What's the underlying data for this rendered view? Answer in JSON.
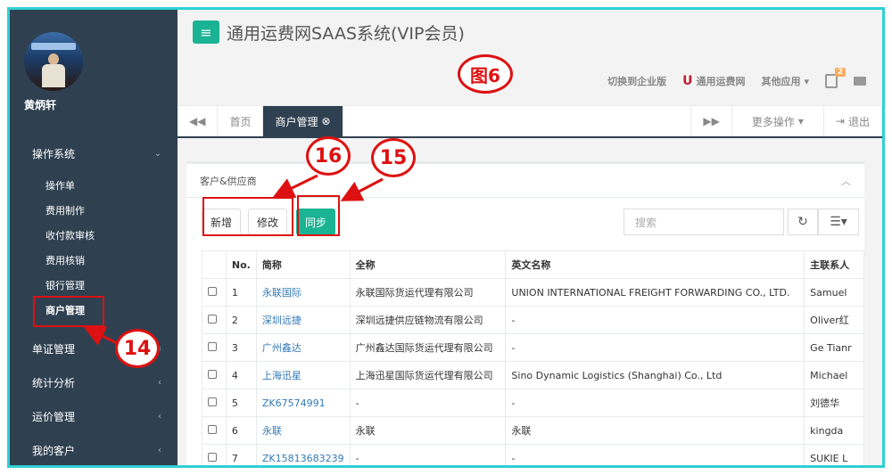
{
  "sidebar": {
    "username": "黄炳轩",
    "groups": [
      {
        "label": "操作系统",
        "items": [
          "操作单",
          "费用制作",
          "收付款审核",
          "费用核销",
          "银行管理",
          "商户管理"
        ]
      },
      {
        "label": "单证管理"
      },
      {
        "label": "统计分析"
      },
      {
        "label": "运价管理"
      },
      {
        "label": "我的客户"
      }
    ]
  },
  "header": {
    "title": "通用运费网SAAS系统(VIP会员)",
    "nav": {
      "enterprise": "切换到企业版",
      "site": "通用运费网",
      "apps": "其他应用",
      "badge": "2"
    }
  },
  "tabs": {
    "home": "首页",
    "current": "商户管理",
    "more": "更多操作",
    "logout": "退出"
  },
  "panel": {
    "title": "客户&供应商",
    "buttons": {
      "add": "新增",
      "edit": "修改",
      "sync": "同步"
    },
    "search_placeholder": "搜索"
  },
  "table": {
    "headers": [
      "No.",
      "简称",
      "全称",
      "英文名称",
      "主联系人"
    ],
    "rows": [
      [
        "1",
        "永联国际",
        "永联国际货运代理有限公司",
        "UNION INTERNATIONAL FREIGHT FORWARDING CO., LTD.",
        "Samuel"
      ],
      [
        "2",
        "深圳远捷",
        "深圳远捷供应链物流有限公司",
        "-",
        "Oliver红"
      ],
      [
        "3",
        "广州鑫达",
        "广州鑫达国际货运代理有限公司",
        "-",
        "Ge Tianr"
      ],
      [
        "4",
        "上海迅星",
        "上海迅星国际货运代理有限公司",
        "Sino Dynamic Logistics (Shanghai) Co., Ltd",
        "Michael"
      ],
      [
        "5",
        "ZK67574991",
        "-",
        "-",
        "刘德华"
      ],
      [
        "6",
        "永联",
        "永联",
        "永联",
        "kingda"
      ],
      [
        "7",
        "ZK15813683239",
        "-",
        "-",
        "SUKIE L"
      ]
    ]
  },
  "annotations": {
    "fig": "图6",
    "n14": "14",
    "n15": "15",
    "n16": "16"
  },
  "colors": {
    "accent": "#1ab394",
    "sidebar": "#2f4050",
    "annotation": "#dd1111",
    "frame": "#2fd0d4"
  }
}
